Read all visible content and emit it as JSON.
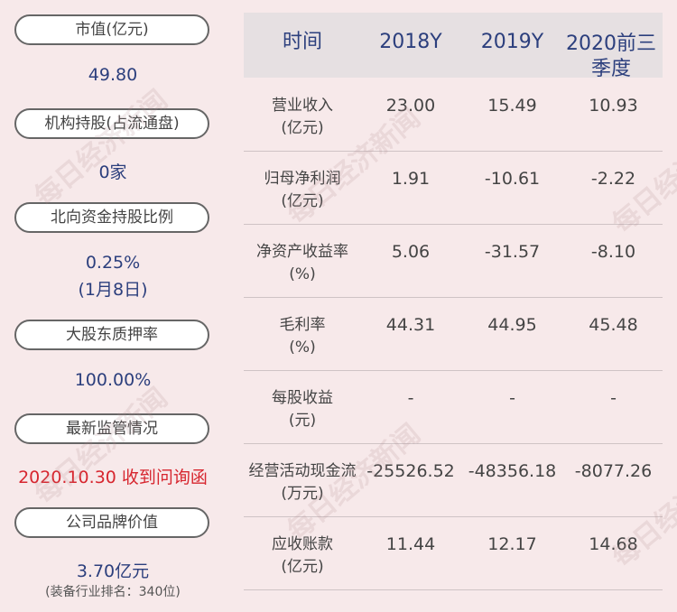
{
  "left": {
    "items": [
      {
        "label": "市值(亿元)",
        "value": "49.80"
      },
      {
        "label": "机构持股(占流通盘)",
        "value": "0家"
      },
      {
        "label": "北向资金持股比例",
        "value": "0.25%",
        "value2": "(1月8日)"
      },
      {
        "label": "大股东质押率",
        "value": "100.00%"
      },
      {
        "label": "最新监管情况",
        "value": "2020.10.30 收到问询函"
      },
      {
        "label": "公司品牌价值",
        "value": "3.70亿元",
        "note": "(装备行业排名：340位)"
      }
    ]
  },
  "table": {
    "headers": [
      "时间",
      "2018Y",
      "2019Y",
      "2020前三季度"
    ],
    "header_last_line1": "2020前三",
    "header_last_line2": "季度",
    "rows": [
      {
        "name": "营业收入",
        "unit": "(亿元)",
        "values": [
          "23.00",
          "15.49",
          "10.93"
        ]
      },
      {
        "name": "归母净利润",
        "unit": "(亿元)",
        "values": [
          "1.91",
          "-10.61",
          "-2.22"
        ]
      },
      {
        "name": "净资产收益率",
        "unit": "(%)",
        "values": [
          "5.06",
          "-31.57",
          "-8.10"
        ]
      },
      {
        "name": "毛利率",
        "unit": "(%)",
        "values": [
          "44.31",
          "44.95",
          "45.48"
        ]
      },
      {
        "name": "每股收益",
        "unit": "(元)",
        "values": [
          "-",
          "-",
          "-"
        ]
      },
      {
        "name": "经营活动现金流",
        "unit": "(万元)",
        "values": [
          "-25526.52",
          "-48356.18",
          "-8077.26"
        ]
      },
      {
        "name": "应收账款",
        "unit": "(亿元)",
        "values": [
          "11.44",
          "12.17",
          "14.68"
        ]
      }
    ]
  },
  "watermark": "每日经济新闻"
}
